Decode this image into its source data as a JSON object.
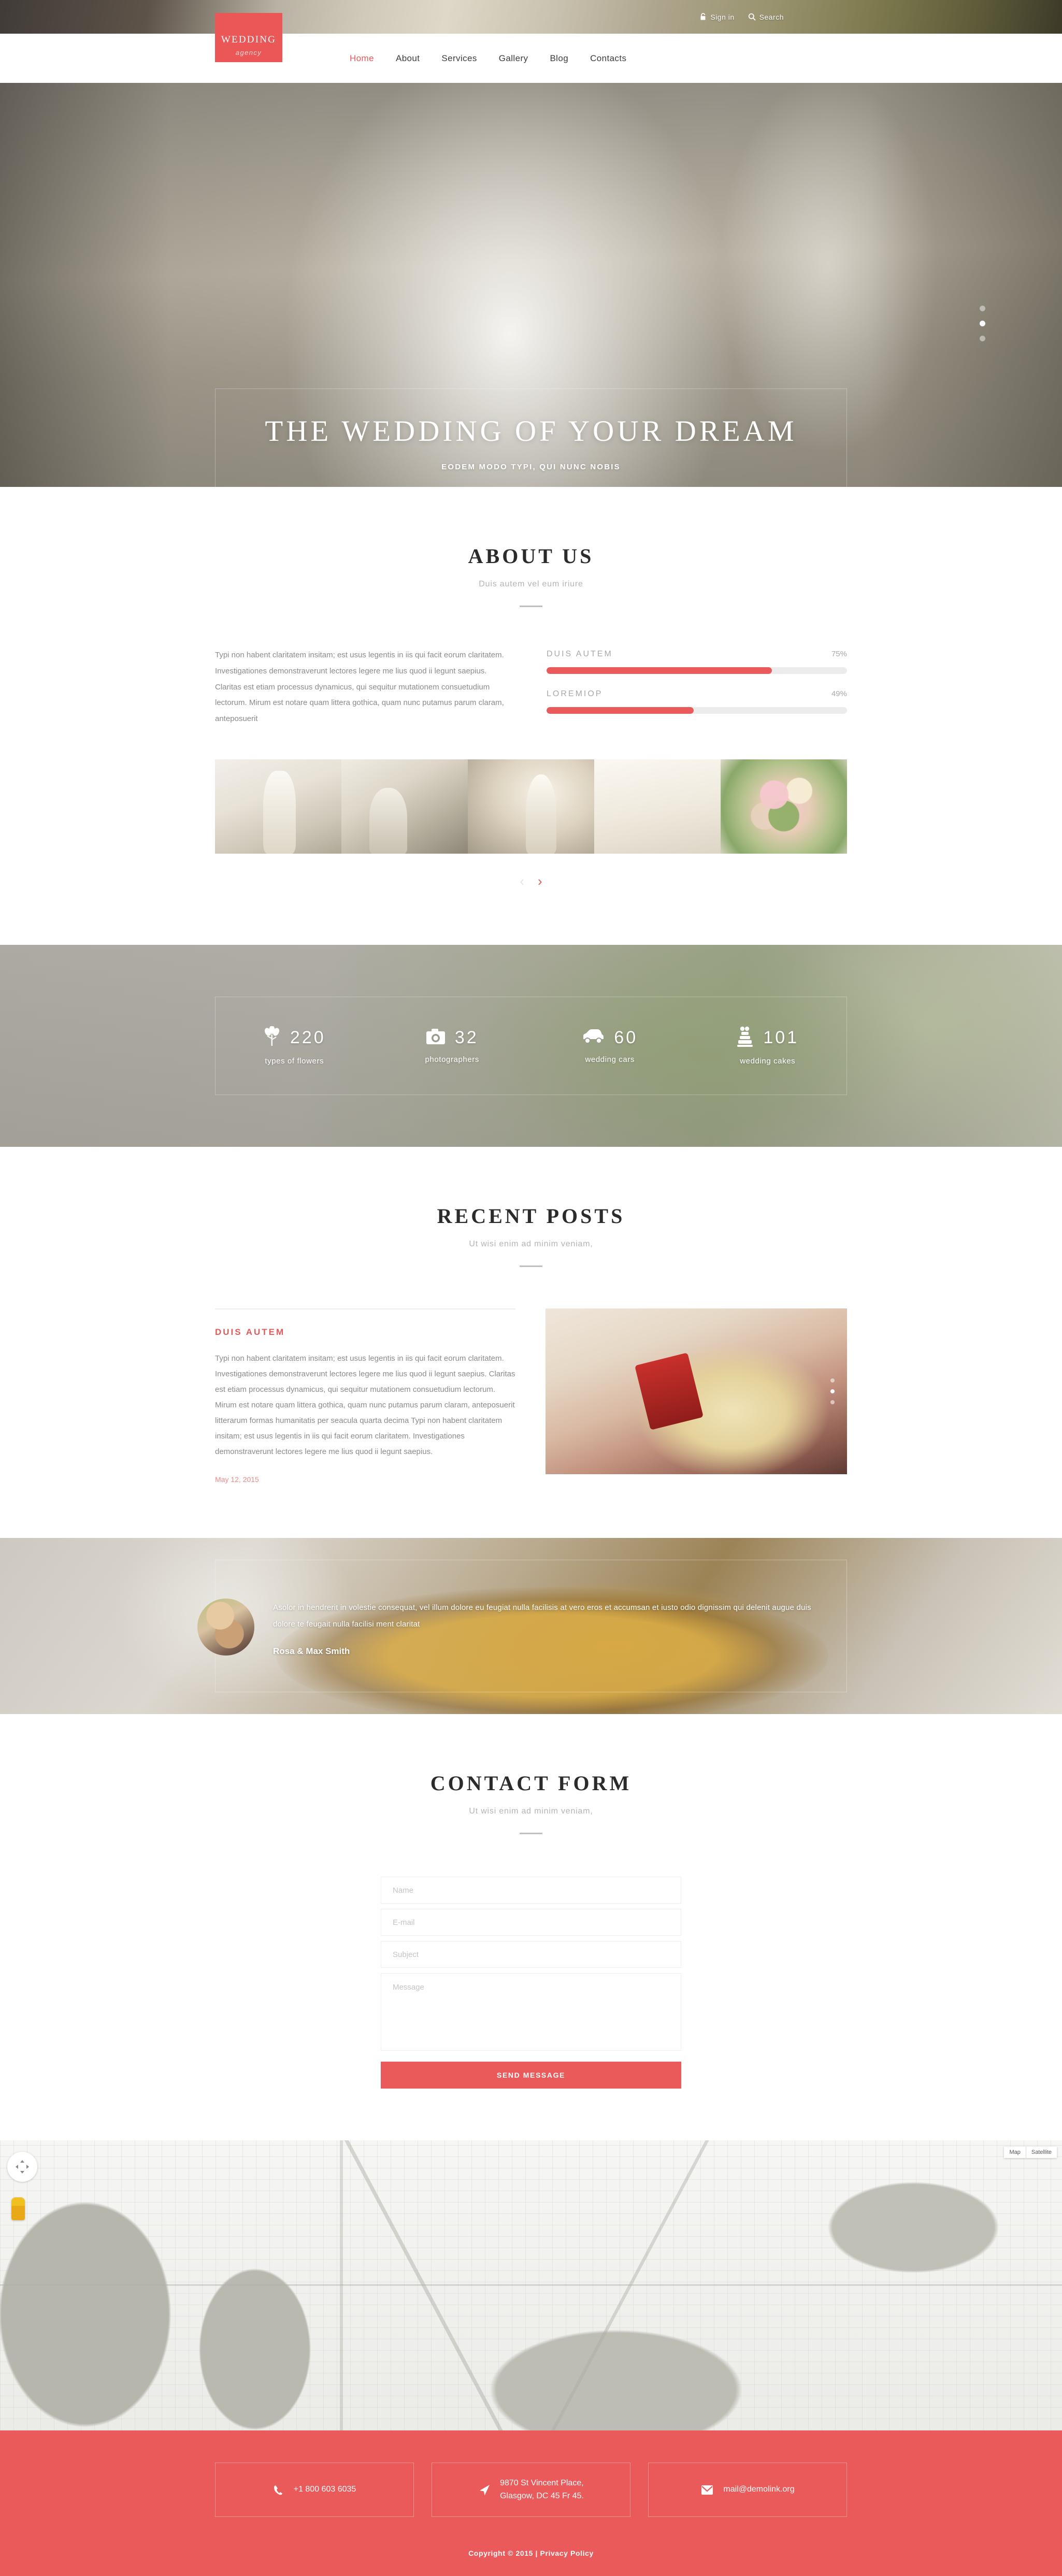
{
  "topbar": {
    "signin_label": "Sign in",
    "signin_icon": "lock-icon",
    "search_label": "Search",
    "search_icon": "search-icon"
  },
  "logo": {
    "line1": "WEDDING",
    "line2": "agency"
  },
  "nav": {
    "items": [
      {
        "label": "Home",
        "active": true
      },
      {
        "label": "About",
        "active": false
      },
      {
        "label": "Services",
        "active": false
      },
      {
        "label": "Gallery",
        "active": false
      },
      {
        "label": "Blog",
        "active": false
      },
      {
        "label": "Contacts",
        "active": false
      }
    ]
  },
  "hero": {
    "title": "THE WEDDING OF YOUR DREAM",
    "subtitle": "EODEM MODO TYPI, QUI NUNC NOBIS",
    "button_icon": "chevron-right-icon",
    "slides": 3,
    "active_slide": 2
  },
  "about": {
    "title": "ABOUT US",
    "subtitle": "Duis autem vel eum iriure",
    "paragraph": "Typi non habent claritatem insitam; est usus legentis in iis qui facit eorum claritatem. Investigationes demonstraverunt lectores legere me lius quod ii legunt saepius. Claritas est etiam processus dynamicus, qui sequitur mutationem consuetudium lectorum. Mirum est notare quam littera gothica, quam nunc putamus parum claram, anteposuerit",
    "bars": [
      {
        "label": "DUIS AUTEM",
        "percent": "75%",
        "value": 75
      },
      {
        "label": "LOREMIOP",
        "percent": "49%",
        "value": 49
      }
    ],
    "gallery_prev_icon": "chevron-left-icon",
    "gallery_next_icon": "chevron-right-icon"
  },
  "counters": {
    "items": [
      {
        "icon": "flowers-icon",
        "number": "220",
        "label": "types of flowers"
      },
      {
        "icon": "camera-icon",
        "number": "32",
        "label": "photographers"
      },
      {
        "icon": "car-icon",
        "number": "60",
        "label": "wedding cars"
      },
      {
        "icon": "cake-icon",
        "number": "101",
        "label": "wedding cakes"
      }
    ]
  },
  "posts": {
    "title": "RECENT POSTS",
    "subtitle": "Ut wisi enim ad minim veniam,",
    "item": {
      "heading": "DUIS AUTEM",
      "body": "Typi non habent claritatem insitam; est usus legentis in iis qui facit eorum claritatem. Investigationes demonstraverunt lectores legere me lius quod ii legunt saepius. Claritas est etiam processus dynamicus, qui sequitur mutationem consuetudium lectorum. Mirum est notare quam littera gothica, quam nunc putamus parum claram, anteposuerit litterarum formas humanitatis per seacula quarta decima Typi non habent claritatem insitam; est usus legentis in iis qui facit eorum claritatem. Investigationes demonstraverunt lectores legere me lius quod ii legunt saepius.",
      "date": "May 12, 2015"
    }
  },
  "testimonial": {
    "quote": "Asolor in hendrerit in volestie consequat, vel illum dolore eu feugiat nulla facilisis at vero eros et accumsan et iusto odio dignissim qui  delenit augue duis dolore te feugait nulla facilisi ment claritat",
    "author": "Rosa & Max Smith",
    "avatar": "couple-avatar"
  },
  "contact": {
    "title": "CONTACT FORM",
    "subtitle": "Ut wisi enim ad minim veniam,",
    "fields": {
      "name_placeholder": "Name",
      "email_placeholder": "E-mail",
      "subject_placeholder": "Subject",
      "message_placeholder": "Message"
    },
    "submit_label": "SEND MESSAGE"
  },
  "map": {
    "type_map_label": "Map",
    "type_satellite_label": "Satellite",
    "pan_icon": "pan-control-icon",
    "pegman_icon": "street-view-pegman-icon"
  },
  "footer": {
    "cards": [
      {
        "icon": "phone-icon",
        "text": "+1 800 603 6035"
      },
      {
        "icon": "location-arrow-icon",
        "text": "9870 St Vincent Place,\nGlasgow, DC 45 Fr 45."
      },
      {
        "icon": "envelope-icon",
        "text": "mail@demolink.org"
      }
    ],
    "copyright": "Copyright © 2015 | Privacy Policy"
  },
  "colors": {
    "accent": "#ea5a5a",
    "accent_dark": "#e35a5a",
    "text_dark": "#2b2b2b",
    "text_muted": "#8b8b8b"
  }
}
